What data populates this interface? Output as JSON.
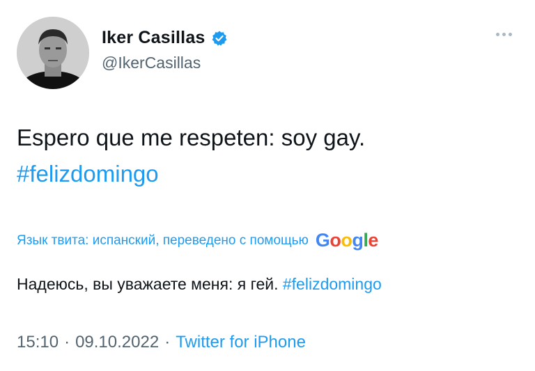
{
  "author": {
    "display_name": "Iker Casillas",
    "handle": "@IkerCasillas",
    "verified_icon": "verified-badge-icon",
    "avatar_icon": "profile-photo-avatar"
  },
  "menu": {
    "more_icon": "more-options-icon"
  },
  "tweet": {
    "text_main": "Espero que me respeten: soy gay.",
    "hashtag": "#felizdomingo"
  },
  "translation": {
    "label": "Язык твита: испанский, переведено с помощью",
    "provider": "Google",
    "text": "Надеюсь, вы уважаете меня: я гей.",
    "hashtag": "#felizdomingo"
  },
  "meta": {
    "time": "15:10",
    "separator": "·",
    "date": "09.10.2022",
    "source": "Twitter for iPhone"
  },
  "colors": {
    "link": "#1d9bf0",
    "secondary_text": "#536471",
    "primary_text": "#0f1419",
    "verified": "#1d9bf0"
  }
}
